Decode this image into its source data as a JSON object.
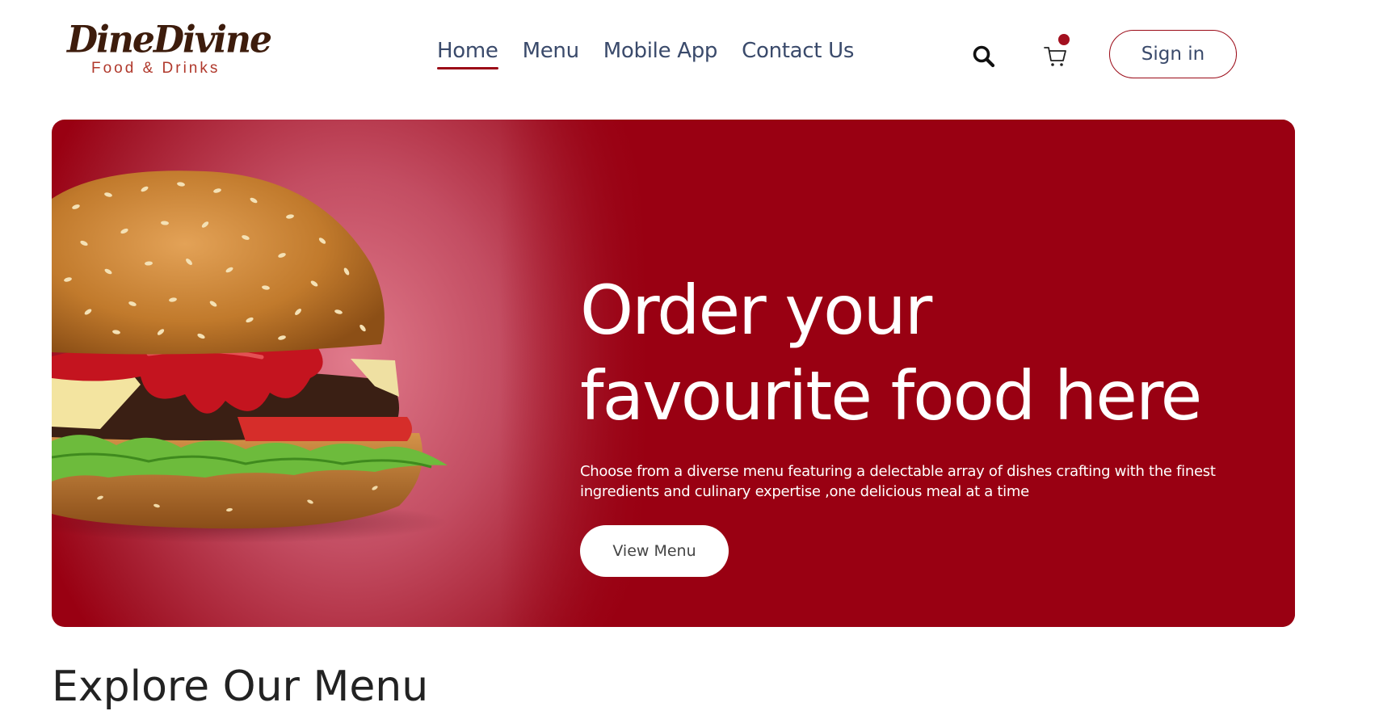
{
  "brand": {
    "name": "DineDivine",
    "tagline": "Food & Drinks"
  },
  "nav": {
    "items": [
      {
        "label": "Home",
        "active": true
      },
      {
        "label": "Menu",
        "active": false
      },
      {
        "label": "Mobile App",
        "active": false
      },
      {
        "label": "Contact Us",
        "active": false
      }
    ]
  },
  "header": {
    "search_icon": "search-icon",
    "cart_icon": "cart-icon",
    "cart_has_items": true,
    "signin_label": "Sign in"
  },
  "hero": {
    "title_line1": "Order your",
    "title_line2": "favourite food here",
    "description_line1": "Choose from a diverse menu featuring a delectable array of dishes crafting with the finest",
    "description_line2": "ingredients and culinary expertise ,one delicious meal at a time",
    "cta_label": "View Menu",
    "image": "burger-image"
  },
  "next_section": {
    "heading": "Explore Our Menu"
  },
  "colors": {
    "accent": "#990012",
    "nav_text": "#3a4a6b",
    "logo_brown": "#3d1c0c",
    "logo_sub": "#b0382b"
  }
}
